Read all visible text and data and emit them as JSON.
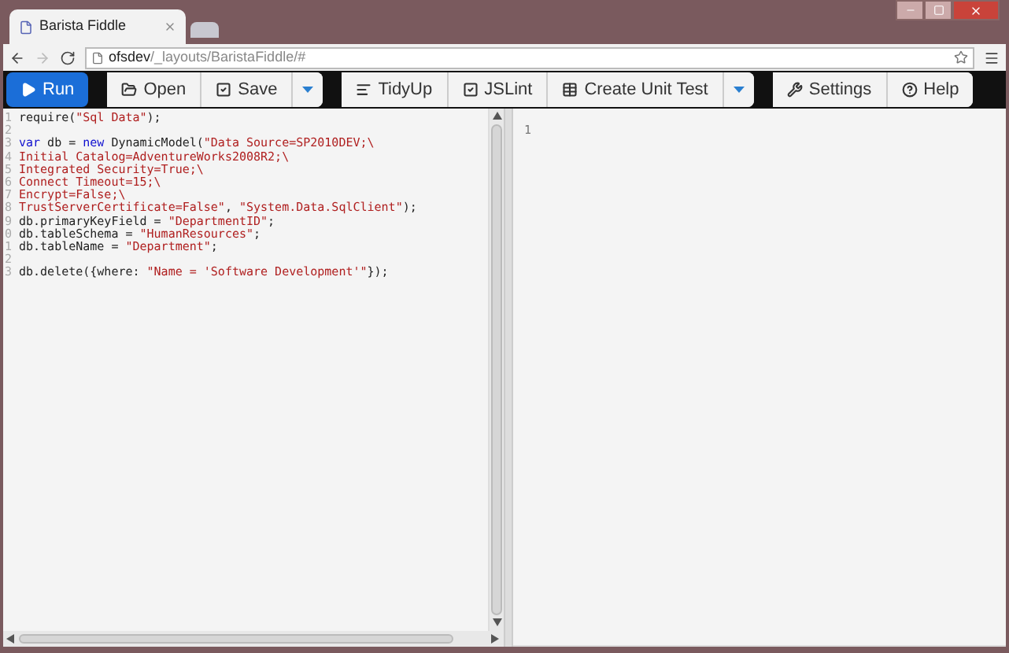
{
  "window": {
    "tab_title": "Barista Fiddle",
    "address": {
      "host": "ofsdev",
      "path": "/_layouts/BaristaFiddle/#"
    }
  },
  "toolbar": {
    "groups": [
      {
        "buttons": [
          {
            "label": "Run",
            "kind": "primary"
          }
        ]
      },
      {
        "buttons": [
          {
            "label": "Open",
            "kind": "default"
          },
          {
            "label": "Save",
            "kind": "default"
          },
          {
            "kind": "caret"
          }
        ]
      },
      {
        "buttons": [
          {
            "label": "TidyUp",
            "kind": "default"
          },
          {
            "label": "JSLint",
            "kind": "default"
          },
          {
            "label": "Create Unit Test",
            "kind": "default"
          },
          {
            "kind": "caret"
          }
        ]
      },
      {
        "buttons": [
          {
            "label": "Settings",
            "kind": "default"
          },
          {
            "label": "Help",
            "kind": "default"
          }
        ]
      }
    ]
  },
  "editor": {
    "lines": [
      {
        "number": "1",
        "tokens": [
          {
            "kind": "plain",
            "text": "require("
          },
          {
            "kind": "string",
            "text": "\"Sql Data\""
          },
          {
            "kind": "plain",
            "text": ");"
          }
        ]
      },
      {
        "number": "2"
      },
      {
        "number": "3",
        "tokens": [
          {
            "kind": "keyword",
            "text": "var"
          },
          {
            "kind": "plain",
            "text": " db = "
          },
          {
            "kind": "keyword",
            "text": "new"
          },
          {
            "kind": "plain",
            "text": " DynamicModel("
          },
          {
            "kind": "string",
            "text": "\"Data Source=SP2010DEV;\\"
          }
        ]
      },
      {
        "number": "4",
        "tokens": [
          {
            "kind": "string",
            "text": "Initial Catalog=AdventureWorks2008R2;\\"
          }
        ]
      },
      {
        "number": "5",
        "tokens": [
          {
            "kind": "string",
            "text": "Integrated Security=True;\\"
          }
        ]
      },
      {
        "number": "6",
        "tokens": [
          {
            "kind": "string",
            "text": "Connect Timeout=15;\\"
          }
        ]
      },
      {
        "number": "7",
        "tokens": [
          {
            "kind": "string",
            "text": "Encrypt=False;\\"
          }
        ]
      },
      {
        "number": "8",
        "tokens": [
          {
            "kind": "string",
            "text": "TrustServerCertificate=False\""
          },
          {
            "kind": "plain",
            "text": ", "
          },
          {
            "kind": "string",
            "text": "\"System.Data.SqlClient\""
          },
          {
            "kind": "plain",
            "text": ");"
          }
        ]
      },
      {
        "number": "9",
        "tokens": [
          {
            "kind": "plain",
            "text": "db.primaryKeyField = "
          },
          {
            "kind": "string",
            "text": "\"DepartmentID\""
          },
          {
            "kind": "plain",
            "text": ";"
          }
        ]
      },
      {
        "number": "0",
        "tokens": [
          {
            "kind": "plain",
            "text": "db.tableSchema = "
          },
          {
            "kind": "string",
            "text": "\"HumanResources\""
          },
          {
            "kind": "plain",
            "text": ";"
          }
        ]
      },
      {
        "number": "1",
        "tokens": [
          {
            "kind": "plain",
            "text": "db.tableName = "
          },
          {
            "kind": "string",
            "text": "\"Department\""
          },
          {
            "kind": "plain",
            "text": ";"
          }
        ]
      },
      {
        "number": "2"
      },
      {
        "number": "3",
        "tokens": [
          {
            "kind": "plain",
            "text": "db.delete({where: "
          },
          {
            "kind": "string",
            "text": "\"Name = 'Software Development'\""
          },
          {
            "kind": "plain",
            "text": "});"
          }
        ]
      }
    ]
  },
  "output": {
    "lines": [
      {
        "number": "1"
      }
    ]
  }
}
